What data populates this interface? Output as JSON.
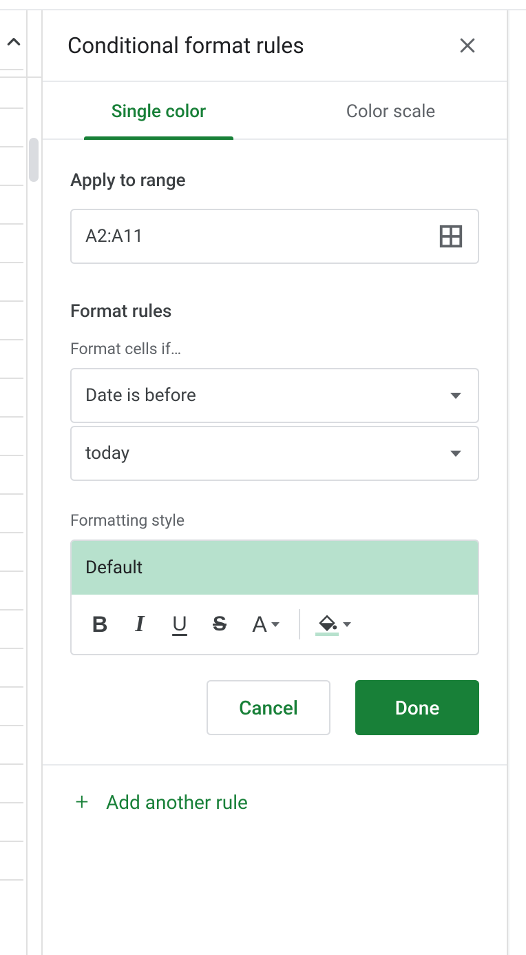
{
  "header": {
    "title": "Conditional format rules"
  },
  "tabs": {
    "single_color": "Single color",
    "color_scale": "Color scale"
  },
  "range": {
    "section_title": "Apply to range",
    "value": "A2:A11"
  },
  "rules": {
    "section_title": "Format rules",
    "cells_if_label": "Format cells if…",
    "condition": "Date is before",
    "condition_value": "today"
  },
  "style": {
    "label": "Formatting style",
    "preview_text": "Default",
    "bold": "B",
    "italic": "I",
    "underline": "U",
    "strike": "S",
    "text_color": "A"
  },
  "actions": {
    "cancel": "Cancel",
    "done": "Done"
  },
  "footer": {
    "add_rule": "Add another rule"
  }
}
